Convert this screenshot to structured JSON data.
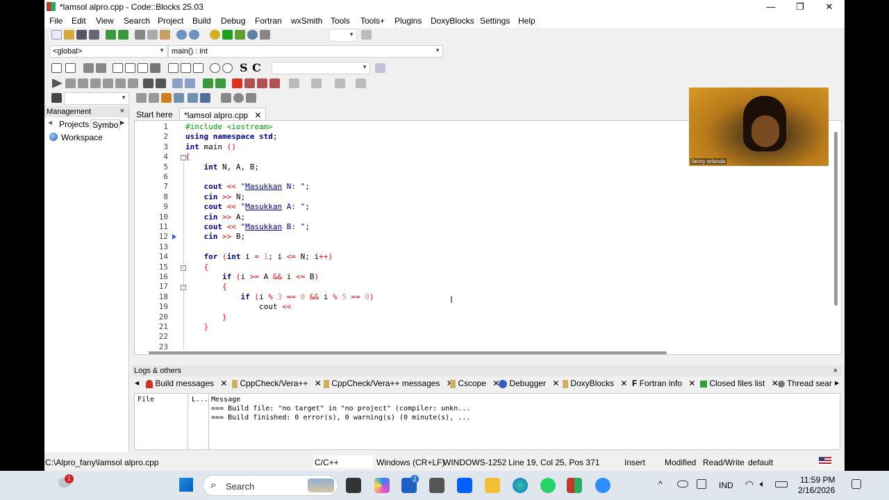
{
  "window": {
    "title": "*lamsol alpro.cpp - Code::Blocks 25.03",
    "minimize": "—",
    "maximize": "❐",
    "close": "✕"
  },
  "menu": [
    "File",
    "Edit",
    "View",
    "Search",
    "Project",
    "Build",
    "Debug",
    "Fortran",
    "wxSmith",
    "Tools",
    "Tools+",
    "Plugins",
    "DoxyBlocks",
    "Settings",
    "Help"
  ],
  "scope_combo": "<global>",
  "function_combo": "main() : int",
  "search_toolbar": {
    "symbols": [
      "S",
      "C"
    ],
    "combo_value": ""
  },
  "management": {
    "title": "Management",
    "close": "×",
    "tabs": [
      "Projects",
      "Symbo"
    ],
    "tree_root": "Workspace"
  },
  "editor": {
    "tabs": [
      {
        "label": "Start here",
        "close": "✕"
      },
      {
        "label": "*lamsol alpro.cpp",
        "close": "✕"
      }
    ],
    "line_numbers": [
      "1",
      "2",
      "3",
      "4",
      "5",
      "6",
      "7",
      "8",
      "9",
      "10",
      "11",
      "12",
      "13",
      "14",
      "15",
      "16",
      "17",
      "18",
      "19",
      "20",
      "21",
      "22",
      "23"
    ]
  },
  "logs": {
    "title": "Logs & others",
    "close": "×",
    "tabs": [
      {
        "label": "Build messages",
        "close": "✕"
      },
      {
        "label": "CppCheck/Vera++",
        "close": "✕"
      },
      {
        "label": "CppCheck/Vera++ messages",
        "close": "✕"
      },
      {
        "label": "Cscope",
        "close": "✕"
      },
      {
        "label": "Debugger",
        "close": "✕"
      },
      {
        "label": "DoxyBlocks",
        "close": "✕"
      },
      {
        "label": "Fortran info",
        "close": "✕"
      },
      {
        "label": "Closed files list",
        "close": "✕"
      },
      {
        "label": "Thread searc",
        "close": ""
      }
    ],
    "columns": [
      "File",
      "L...",
      "Message"
    ],
    "messages": [
      "=== Build file: \"no target\" in \"no project\" (compiler: unkn...",
      "=== Build finished: 0 error(s), 0 warning(s) (0 minute(s), ..."
    ]
  },
  "status": {
    "path": "C:\\Alpro_fany\\lamsol alpro.cpp",
    "language": "C/C++",
    "eol": "Windows (CR+LF)",
    "encoding": "WINDOWS-1252",
    "position": "Line 19, Col 25, Pos 371",
    "mode": "Insert",
    "modified": "Modified",
    "access": "Read/Write",
    "profile": "default"
  },
  "webcam": {
    "name": "fanny erlanda"
  },
  "taskbar": {
    "notification_badge": "1",
    "search_placeholder": "Search",
    "store_badge": "2",
    "language": "IND",
    "time": "11:59 PM",
    "date": "2/16/2026"
  },
  "colors": {
    "keyword": "#00008b",
    "preprocessor": "#00a000",
    "operator": "#ff0000",
    "number": "#f08080",
    "string": "#00008b"
  }
}
